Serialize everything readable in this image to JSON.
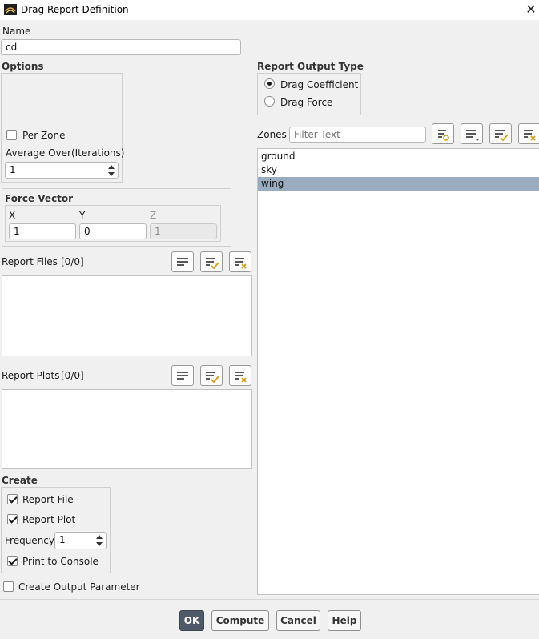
{
  "window": {
    "title": "Drag Report Definition",
    "close_glyph": "✕"
  },
  "name": {
    "label": "Name",
    "value": "cd"
  },
  "options": {
    "label": "Options",
    "per_zone": {
      "label": "Per Zone",
      "checked": false
    },
    "average_over": {
      "label": "Average Over(Iterations)",
      "value": "1"
    }
  },
  "report_output_type": {
    "label": "Report Output Type",
    "options": [
      {
        "label": "Drag Coefficient",
        "selected": true
      },
      {
        "label": "Drag Force",
        "selected": false
      }
    ]
  },
  "zones": {
    "label": "Zones",
    "filter_placeholder": "Filter Text",
    "items": [
      {
        "label": "ground",
        "selected": false
      },
      {
        "label": "sky",
        "selected": false
      },
      {
        "label": "wing",
        "selected": true
      }
    ]
  },
  "force_vector": {
    "label": "Force Vector",
    "x": {
      "label": "X",
      "value": "1"
    },
    "y": {
      "label": "Y",
      "value": "0"
    },
    "z": {
      "label": "Z",
      "value": "1",
      "disabled": true
    }
  },
  "report_files": {
    "label": "Report Files",
    "count": "[0/0]"
  },
  "report_plots": {
    "label": "Report Plots",
    "count": "[0/0]"
  },
  "create": {
    "label": "Create",
    "report_file": {
      "label": "Report File",
      "checked": true
    },
    "report_plot": {
      "label": "Report Plot",
      "checked": true
    },
    "frequency": {
      "label": "Frequency",
      "value": "1"
    },
    "print_to_console": {
      "label": "Print to Console",
      "checked": true
    }
  },
  "create_output_parameter": {
    "label": "Create Output Parameter",
    "checked": false
  },
  "buttons": {
    "ok": "OK",
    "compute": "Compute",
    "cancel": "Cancel",
    "help": "Help"
  },
  "colors": {
    "dialog_bg": "#f0f0f0",
    "selection": "#9aacc0",
    "primary_button": "#4e5a68",
    "check_accent": "#d4a017"
  }
}
